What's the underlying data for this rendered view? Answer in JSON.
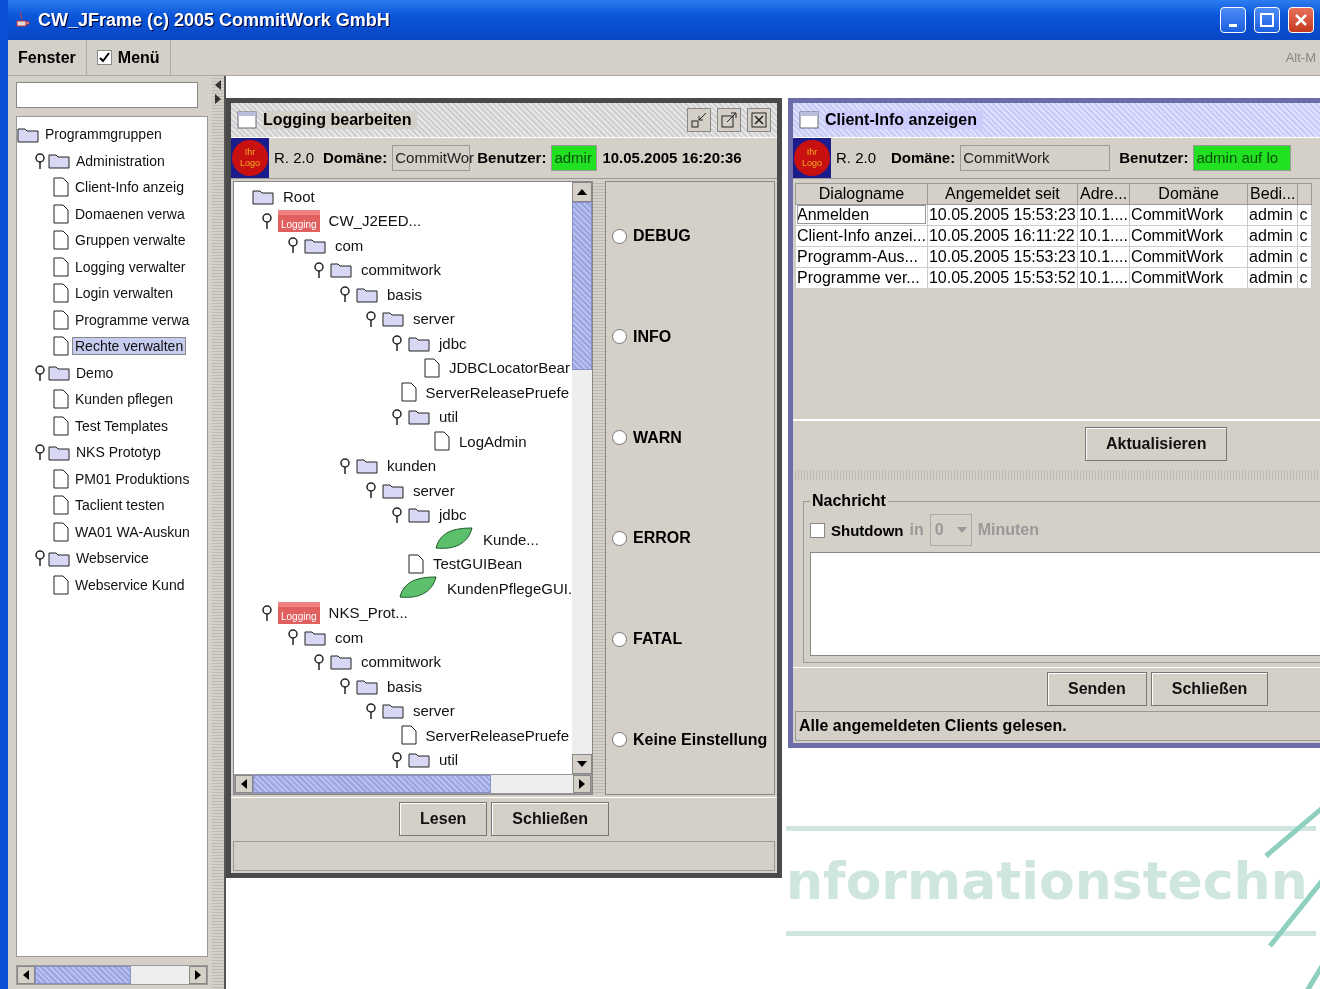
{
  "window": {
    "title": "CW_JFrame (c) 2005 CommitWork GmbH"
  },
  "menu_bar": {
    "items": [
      {
        "label": "Fenster",
        "kind": "menu"
      },
      {
        "label": "Menü",
        "kind": "check",
        "checked": true
      }
    ],
    "shortcut_hint": "Alt-M"
  },
  "sidebar": {
    "tree": [
      {
        "label": "Programmgruppen",
        "kind": "root",
        "selected": false,
        "children": [
          {
            "label": "Administration",
            "kind": "folder",
            "expanded": true,
            "selected": false,
            "children": [
              {
                "label": "Client-Info anzeig",
                "kind": "file",
                "selected": false
              },
              {
                "label": "Domaenen verwa",
                "kind": "file",
                "selected": false
              },
              {
                "label": "Gruppen verwalte",
                "kind": "file",
                "selected": false
              },
              {
                "label": "Logging verwalter",
                "kind": "file",
                "selected": false
              },
              {
                "label": "Login verwalten",
                "kind": "file",
                "selected": false
              },
              {
                "label": "Programme verwa",
                "kind": "file",
                "selected": false
              },
              {
                "label": "Rechte verwalten",
                "kind": "file",
                "selected": true
              }
            ]
          },
          {
            "label": "Demo",
            "kind": "folder",
            "expanded": true,
            "selected": false,
            "children": [
              {
                "label": "Kunden pflegen",
                "kind": "file",
                "selected": false
              },
              {
                "label": "Test Templates",
                "kind": "file",
                "selected": false
              }
            ]
          },
          {
            "label": "NKS Prototyp",
            "kind": "folder",
            "expanded": true,
            "selected": false,
            "children": [
              {
                "label": "PM01 Produktions",
                "kind": "file",
                "selected": false
              },
              {
                "label": "Taclient testen",
                "kind": "file",
                "selected": false
              },
              {
                "label": "WA01 WA-Auskun",
                "kind": "file",
                "selected": false
              }
            ]
          },
          {
            "label": "Webservice",
            "kind": "folder",
            "expanded": true,
            "selected": false,
            "children": [
              {
                "label": "Webservice Kund",
                "kind": "file",
                "selected": false
              }
            ]
          }
        ]
      }
    ]
  },
  "desktop": {
    "background_text": "nformationstechn"
  },
  "logging_frame": {
    "title": "Logging bearbeiten",
    "active": false,
    "header": {
      "logo": [
        "Ihr",
        "Logo"
      ],
      "release": "R. 2.0",
      "domain_label": "Domäne:",
      "domain": "CommitWor",
      "user_label": "Benutzer:",
      "user": "admir",
      "timestamp": "10.05.2005 16:20:36"
    },
    "tree": [
      {
        "label": "Root",
        "kind": "folder",
        "selected": false,
        "children": [
          {
            "label": "CW_J2EED...",
            "kind": "logging",
            "badge": "Logging",
            "expanded": true,
            "selected": false,
            "children": [
              {
                "label": "com",
                "kind": "folder",
                "expanded": true,
                "selected": false,
                "children": [
                  {
                    "label": "commitwork",
                    "kind": "folder",
                    "expanded": true,
                    "selected": false,
                    "children": [
                      {
                        "label": "basis",
                        "kind": "folder",
                        "expanded": true,
                        "selected": false,
                        "children": [
                          {
                            "label": "server",
                            "kind": "folder",
                            "expanded": true,
                            "selected": false,
                            "children": [
                              {
                                "label": "jdbc",
                                "kind": "folder",
                                "expanded": true,
                                "selected": false,
                                "children": [
                                  {
                                    "label": "JDBCLocatorBear",
                                    "kind": "file",
                                    "selected": false
                                  }
                                ]
                              },
                              {
                                "label": "ServerReleasePruefe",
                                "kind": "file",
                                "selected": false
                              },
                              {
                                "label": "util",
                                "kind": "folder",
                                "expanded": true,
                                "selected": false,
                                "children": [
                                  {
                                    "label": "LogAdmin",
                                    "kind": "file",
                                    "selected": false
                                  }
                                ]
                              }
                            ]
                          }
                        ]
                      },
                      {
                        "label": "kunden",
                        "kind": "folder",
                        "expanded": true,
                        "selected": false,
                        "children": [
                          {
                            "label": "server",
                            "kind": "folder",
                            "expanded": true,
                            "selected": false,
                            "children": [
                              {
                                "label": "jdbc",
                                "kind": "folder",
                                "expanded": true,
                                "selected": false,
                                "children": [
                                  {
                                    "label": "Kunde...",
                                    "kind": "logged",
                                    "selected": false
                                  }
                                ]
                              },
                              {
                                "label": "TestGUIBean",
                                "kind": "file",
                                "selected": false
                              },
                              {
                                "label": "KundenPflegeGUI.",
                                "kind": "logged",
                                "selected": false
                              }
                            ]
                          }
                        ]
                      }
                    ]
                  }
                ]
              }
            ]
          },
          {
            "label": "NKS_Prot...",
            "kind": "logging",
            "badge": "Logging",
            "expanded": true,
            "selected": false,
            "children": [
              {
                "label": "com",
                "kind": "folder",
                "expanded": true,
                "selected": false,
                "children": [
                  {
                    "label": "commitwork",
                    "kind": "folder",
                    "expanded": true,
                    "selected": false,
                    "children": [
                      {
                        "label": "basis",
                        "kind": "folder",
                        "expanded": true,
                        "selected": false,
                        "children": [
                          {
                            "label": "server",
                            "kind": "folder",
                            "expanded": true,
                            "selected": false,
                            "children": [
                              {
                                "label": "ServerReleasePruefe",
                                "kind": "file",
                                "selected": false
                              },
                              {
                                "label": "util",
                                "kind": "folder",
                                "expanded": true,
                                "selected": false
                              }
                            ]
                          }
                        ]
                      }
                    ]
                  }
                ]
              }
            ]
          }
        ]
      }
    ],
    "levels": [
      {
        "label": "DEBUG",
        "selected": false
      },
      {
        "label": "INFO",
        "selected": false
      },
      {
        "label": "WARN",
        "selected": false
      },
      {
        "label": "ERROR",
        "selected": false
      },
      {
        "label": "FATAL",
        "selected": false
      },
      {
        "label": "Keine Einstellung",
        "selected": false
      }
    ],
    "buttons": [
      "Lesen",
      "Schließen"
    ]
  },
  "client_frame": {
    "title": "Client-Info anzeigen",
    "active": true,
    "header": {
      "logo": [
        "Ihr",
        "Logo"
      ],
      "release": "R. 2.0",
      "domain_label": "Domäne:",
      "domain": "CommitWork",
      "user_label": "Benutzer:",
      "user": "admin auf lo"
    },
    "table": {
      "columns": [
        "Dialogname",
        "Angemeldet seit",
        "Adre...",
        "Domäne",
        "Bedi...",
        ""
      ],
      "rows": [
        {
          "selected": false,
          "cells": [
            "Anmelden",
            "10.05.2005 15:53:23",
            "10.1....",
            "CommitWork",
            "admin",
            "c"
          ]
        },
        {
          "selected": false,
          "cells": [
            "Client-Info anzei...",
            "10.05.2005 16:11:22",
            "10.1....",
            "CommitWork",
            "admin",
            "c"
          ]
        },
        {
          "selected": false,
          "cells": [
            "Programm-Aus...",
            "10.05.2005 15:53:23",
            "10.1....",
            "CommitWork",
            "admin",
            "c"
          ]
        },
        {
          "selected": false,
          "cells": [
            "Programme ver...",
            "10.05.2005 15:53:52",
            "10.1....",
            "CommitWork",
            "admin",
            "c"
          ]
        }
      ]
    },
    "refresh_button": "Aktualisieren",
    "message": {
      "title": "Nachricht",
      "shutdown_label": "Shutdown",
      "shutdown_checked": false,
      "in_label": "in",
      "minutes_value": "0",
      "minutes_label": "Minuten"
    },
    "buttons": [
      "Senden",
      "Schließen"
    ],
    "status": "Alle angemeldeten Clients gelesen."
  }
}
